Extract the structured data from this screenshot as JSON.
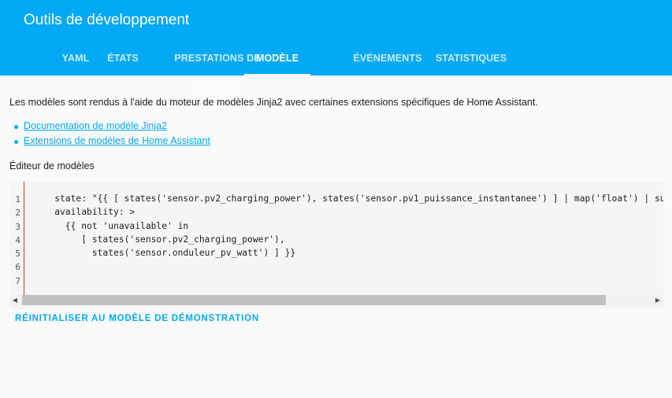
{
  "header": {
    "title": "Outils de développement",
    "tabs": [
      {
        "label": "YAML"
      },
      {
        "label": "ÉTATS"
      },
      {
        "label": "PRESTATIONS DE SERVICE"
      },
      {
        "label": "MODÈLE"
      },
      {
        "label": "ÉVÉNEMENTS"
      },
      {
        "label": "STATISTIQUES"
      }
    ],
    "active_tab": "MODÈLE"
  },
  "main": {
    "intro": "Les modèles sont rendus à l'aide du moteur de modèles Jinja2 avec certaines extensions spécifiques de Home Assistant.",
    "links": [
      {
        "label": "Documentation de modèle Jinja2"
      },
      {
        "label": "Extensions de modèles de Home Assistant"
      }
    ],
    "editor_label": "Éditeur de modèles",
    "editor": {
      "line_numbers": [
        "1",
        "2",
        "3",
        "4",
        "5",
        "6",
        "7"
      ],
      "lines": [
        "    state: \"{{ [ states('sensor.pv2_charging_power'), states('sensor.pv1_puissance_instantanee') ] | map('float') | su",
        "    availability: >",
        "      {{ not 'unavailable' in",
        "         [ states('sensor.pv2_charging_power'),",
        "           states('sensor.onduleur_pv_watt') ] }}",
        "",
        ""
      ]
    },
    "reset_label": "RÉINITIALISER AU MODÈLE DE DÉMONSTRATION"
  },
  "colors": {
    "primary": "#03a9f4",
    "gutter_marker": "#d32f2f"
  }
}
